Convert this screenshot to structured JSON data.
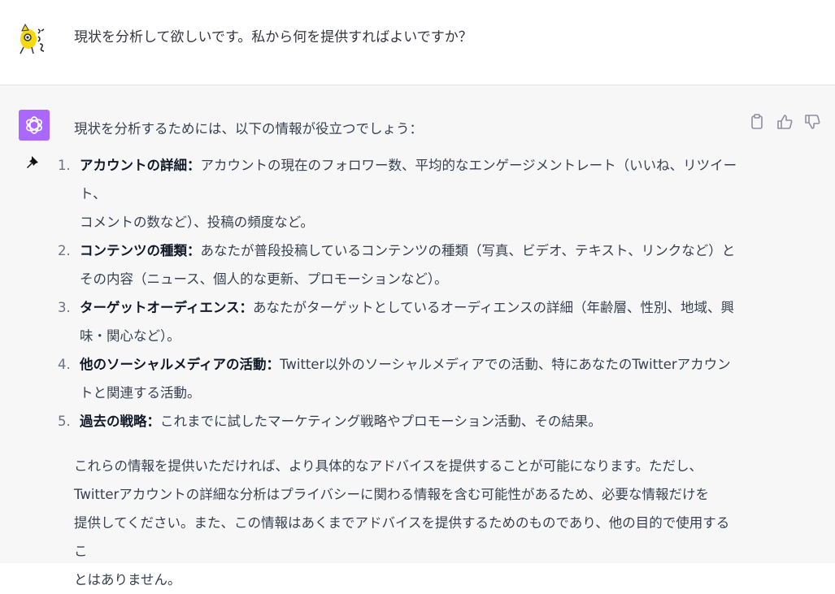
{
  "user": {
    "message": "現状を分析して欲しいです。私から何を提供すればよいですか？"
  },
  "assistant": {
    "intro": "現状を分析するためには、以下の情報が役立つでしょう：",
    "items": [
      {
        "num": "1.",
        "term": "アカウントの詳細",
        "sep": "：",
        "desc_a": "アカウントの現在のフォロワー数、平均的なエンゲージメントレート（いいね、リツイート、",
        "desc_b": "コメントの数など）、投稿の頻度など。"
      },
      {
        "num": "2.",
        "term": "コンテンツの種類",
        "sep": "：",
        "desc_a": "あなたが普段投稿しているコンテンツの種類（写真、ビデオ、テキスト、リンクなど）と",
        "desc_b": "その内容（ニュース、個人的な更新、プロモーションなど）。"
      },
      {
        "num": "3.",
        "term": "ターゲットオーディエンス",
        "sep": "：",
        "desc_a": "あなたがターゲットとしているオーディエンスの詳細（年齢層、性別、地域、興",
        "desc_b": "味・関心など）。"
      },
      {
        "num": "4.",
        "term": "他のソーシャルメディアの活動",
        "sep": "：",
        "desc_a": "Twitter以外のソーシャルメディアでの活動、特にあなたのTwitterアカウン",
        "desc_b": "トと関連する活動。"
      },
      {
        "num": "5.",
        "term": "過去の戦略",
        "sep": "：",
        "desc_a": "これまでに試したマーケティング戦略やプロモーション活動、その結果。",
        "desc_b": ""
      }
    ],
    "closing_lines": [
      "これらの情報を提供いただければ、より具体的なアドバイスを提供することが可能になります。ただし、",
      "Twitterアカウントの詳細な分析はプライバシーに関わる情報を含む可能性があるため、必要な情報だけを",
      "提供してください。また、この情報はあくまでアドバイスを提供するためのものであり、他の目的で使用するこ",
      "とはありません。"
    ]
  },
  "colors": {
    "assistant_avatar_bg": "#ab68ff",
    "assistant_bg": "#f7f7f8"
  },
  "icons": [
    "user-avatar-icon",
    "openai-logo-icon",
    "pin-icon",
    "copy-icon",
    "thumbs-up-icon",
    "thumbs-down-icon"
  ]
}
